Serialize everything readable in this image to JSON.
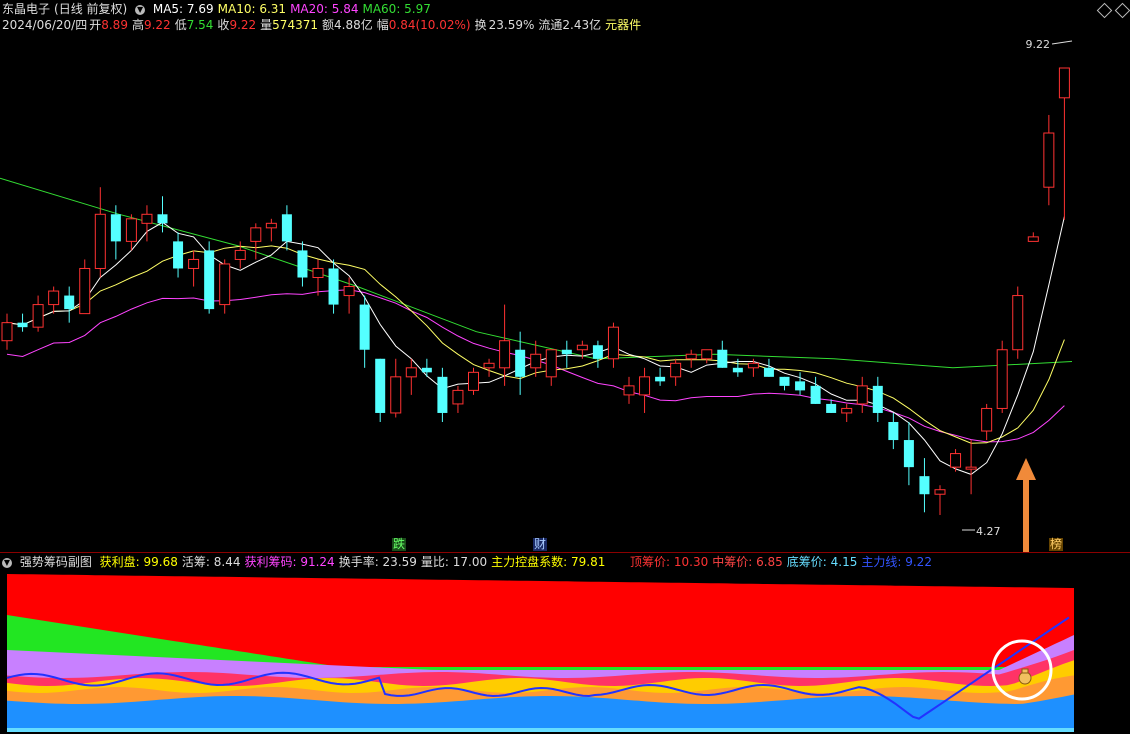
{
  "header": {
    "stock_name": "东晶电子",
    "period": "(日线 前复权)",
    "ma": [
      {
        "label": "MA5:",
        "value": "7.69",
        "color": "#ffffff"
      },
      {
        "label": "MA10:",
        "value": "6.31",
        "color": "#ffff66"
      },
      {
        "label": "MA20:",
        "value": "5.84",
        "color": "#ff44ff"
      },
      {
        "label": "MA60:",
        "value": "5.97",
        "color": "#33dd33"
      }
    ],
    "info": {
      "date": "2024/06/20/四",
      "open_label": "开",
      "open": "8.89",
      "high_label": "高",
      "high": "9.22",
      "low_label": "低",
      "low": "7.54",
      "close_label": "收",
      "close": "9.22",
      "vol_label": "量",
      "vol": "574371",
      "amt_label": "额",
      "amt": "4.88亿",
      "chg_label": "幅",
      "chg": "0.84(10.02%)",
      "turnover_label": "换",
      "turnover": "23.59%",
      "float_label": "流通",
      "float": "2.43亿",
      "sector": "元器件"
    }
  },
  "main_chart": {
    "high_marker": "9.22",
    "low_marker": "4.27",
    "tag_down": "跌",
    "tag_cai": "财",
    "tag_bang": "榜"
  },
  "sub_chart": {
    "title": "强势筹码副图",
    "items": [
      {
        "label": "获利盘:",
        "value": "99.68",
        "color": "#ffff00"
      },
      {
        "label": "活筹:",
        "value": "8.44",
        "color": "#dddddd"
      },
      {
        "label": "获利筹码:",
        "value": "91.24",
        "color": "#ff44ff"
      },
      {
        "label": "换手率:",
        "value": "23.59",
        "color": "#dddddd"
      },
      {
        "label": "量比:",
        "value": "17.00",
        "color": "#dddddd"
      },
      {
        "label": "主力控盘系数:",
        "value": "79.81",
        "color": "#ffff00"
      }
    ],
    "items_right": [
      {
        "label": "顶筹价:",
        "value": "10.30",
        "color": "#ff3333"
      },
      {
        "label": "中筹价:",
        "value": "6.85",
        "color": "#ff4444"
      },
      {
        "label": "底筹价:",
        "value": "4.15",
        "color": "#66ddff"
      },
      {
        "label": "主力线:",
        "value": "9.22",
        "color": "#3355ff"
      }
    ]
  },
  "colors": {
    "up": "#ff3232",
    "down": "#54ffff",
    "ma5": "#ffffff",
    "ma10": "#ffff66",
    "ma20": "#ff44ff",
    "ma60": "#33dd33",
    "arrow": "#f08a3a"
  },
  "icons": [
    "collapse-icon",
    "diamond-icon",
    "moneybag-icon",
    "up-arrow-icon"
  ],
  "chart_data": {
    "type": "candlestick",
    "ma60": [
      [
        "2024-02-01",
        8.0
      ],
      [
        "2024-02-20",
        7.6
      ],
      [
        "2024-03-10",
        7.25
      ],
      [
        "2024-04-01",
        6.8
      ],
      [
        "2024-04-20",
        6.3
      ],
      [
        "2024-05-10",
        6.0
      ],
      [
        "2024-05-25",
        6.05
      ],
      [
        "2024-06-05",
        6.0
      ],
      [
        "2024-06-14",
        5.9
      ],
      [
        "2024-06-20",
        5.97
      ]
    ],
    "candles": [
      [
        6.2,
        6.5,
        6.1,
        6.4
      ],
      [
        6.4,
        6.5,
        6.3,
        6.35
      ],
      [
        6.35,
        6.7,
        6.3,
        6.6
      ],
      [
        6.6,
        6.8,
        6.5,
        6.75
      ],
      [
        6.7,
        6.8,
        6.4,
        6.55
      ],
      [
        6.5,
        7.1,
        6.5,
        7.0
      ],
      [
        7.0,
        7.9,
        6.9,
        7.6
      ],
      [
        7.6,
        7.7,
        7.1,
        7.3
      ],
      [
        7.3,
        7.6,
        7.2,
        7.55
      ],
      [
        7.5,
        7.7,
        7.3,
        7.6
      ],
      [
        7.6,
        7.8,
        7.4,
        7.5
      ],
      [
        7.3,
        7.4,
        6.9,
        7.0
      ],
      [
        7.0,
        7.2,
        6.8,
        7.1
      ],
      [
        7.2,
        7.3,
        6.5,
        6.55
      ],
      [
        6.6,
        7.1,
        6.5,
        7.05
      ],
      [
        7.1,
        7.3,
        7.0,
        7.2
      ],
      [
        7.3,
        7.5,
        7.1,
        7.45
      ],
      [
        7.45,
        7.55,
        7.3,
        7.5
      ],
      [
        7.6,
        7.7,
        7.2,
        7.3
      ],
      [
        7.2,
        7.3,
        6.8,
        6.9
      ],
      [
        6.9,
        7.1,
        6.7,
        7.0
      ],
      [
        7.0,
        7.1,
        6.5,
        6.6
      ],
      [
        6.7,
        6.9,
        6.5,
        6.8
      ],
      [
        6.6,
        6.7,
        5.9,
        6.1
      ],
      [
        6.0,
        6.0,
        5.3,
        5.4
      ],
      [
        5.4,
        6.0,
        5.35,
        5.8
      ],
      [
        5.8,
        6.0,
        5.6,
        5.9
      ],
      [
        5.9,
        6.0,
        5.8,
        5.85
      ],
      [
        5.8,
        5.9,
        5.3,
        5.4
      ],
      [
        5.5,
        5.7,
        5.4,
        5.65
      ],
      [
        5.65,
        5.9,
        5.6,
        5.85
      ],
      [
        5.9,
        6.0,
        5.8,
        5.95
      ],
      [
        5.9,
        6.6,
        5.7,
        6.2
      ],
      [
        6.1,
        6.3,
        5.6,
        5.8
      ],
      [
        5.9,
        6.2,
        5.8,
        6.05
      ],
      [
        5.8,
        6.1,
        5.7,
        6.1
      ],
      [
        6.1,
        6.2,
        5.9,
        6.05
      ],
      [
        6.1,
        6.2,
        6.0,
        6.15
      ],
      [
        6.15,
        6.2,
        5.9,
        6.0
      ],
      [
        6.0,
        6.4,
        5.9,
        6.35
      ],
      [
        5.6,
        5.8,
        5.5,
        5.7
      ],
      [
        5.6,
        5.9,
        5.4,
        5.8
      ],
      [
        5.8,
        5.9,
        5.7,
        5.75
      ],
      [
        5.8,
        6.0,
        5.7,
        5.95
      ],
      [
        6.0,
        6.1,
        5.9,
        6.05
      ],
      [
        6.0,
        6.1,
        5.95,
        6.1
      ],
      [
        6.1,
        6.2,
        5.9,
        5.9
      ],
      [
        5.9,
        6.0,
        5.8,
        5.85
      ],
      [
        5.9,
        6.0,
        5.8,
        5.95
      ],
      [
        5.9,
        6.0,
        5.8,
        5.8
      ],
      [
        5.8,
        5.8,
        5.65,
        5.7
      ],
      [
        5.75,
        5.85,
        5.6,
        5.65
      ],
      [
        5.7,
        5.8,
        5.5,
        5.5
      ],
      [
        5.5,
        5.55,
        5.4,
        5.4
      ],
      [
        5.4,
        5.5,
        5.3,
        5.45
      ],
      [
        5.5,
        5.8,
        5.4,
        5.7
      ],
      [
        5.7,
        5.8,
        5.3,
        5.4
      ],
      [
        5.3,
        5.4,
        5.0,
        5.1
      ],
      [
        5.1,
        5.3,
        4.6,
        4.8
      ],
      [
        4.7,
        4.9,
        4.3,
        4.5
      ],
      [
        4.5,
        4.6,
        4.27,
        4.55
      ],
      [
        4.8,
        5.0,
        4.75,
        4.95
      ],
      [
        4.8,
        5.1,
        4.5,
        4.8
      ],
      [
        5.2,
        5.5,
        5.1,
        5.45
      ],
      [
        5.45,
        6.2,
        5.4,
        6.1
      ],
      [
        6.1,
        6.8,
        6.0,
        6.7
      ],
      [
        7.3,
        7.4,
        7.3,
        7.35
      ],
      [
        7.9,
        8.7,
        7.7,
        8.5
      ],
      [
        8.89,
        9.22,
        7.54,
        9.22
      ]
    ]
  }
}
